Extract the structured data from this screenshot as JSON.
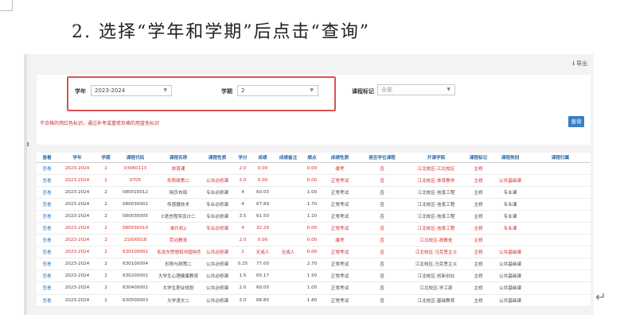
{
  "heading": "2. 选择“学年和学期”后点击“查询”",
  "toolbar": {
    "export_label": "导出",
    "export_icon": "download-icon"
  },
  "filters": {
    "year_label": "学年",
    "year_value": "2023-2024",
    "term_label": "学期",
    "term_value": "2",
    "course_flag_label": "课程标记",
    "course_flag_value": "全部"
  },
  "notice": "不合格的用红色标识，通过补考或重修及格的用蓝色标识",
  "query_label": "查询",
  "table": {
    "columns": [
      "查看",
      "学年",
      "学期",
      "课程代码",
      "课程名称",
      "课程性质",
      "学分",
      "成绩",
      "成绩备注",
      "绩点",
      "成绩性质",
      "是否学位课程",
      "开课学院",
      "课程标记",
      "课程类别",
      "课程归属"
    ],
    "rows": [
      {
        "red": true,
        "cells": [
          "查看",
          "2023-2024",
          "2",
          "03060113",
          "体育课",
          "",
          "2.0",
          "0.00",
          "",
          "0.00",
          "缓考",
          "否",
          "江北校区-江北校区",
          "主修",
          "",
          ""
        ]
      },
      {
        "red": true,
        "cells": [
          "查看",
          "2023-2024",
          "2",
          "0705",
          "形势政策二",
          "公共必修课",
          "2.0",
          "0.00",
          "",
          "0.00",
          "正常考试",
          "否",
          "江北校区-体育教学",
          "主修",
          "公共基础课",
          ""
        ]
      },
      {
        "red": false,
        "cells": [
          "查看",
          "2023-2024",
          "2",
          "080010012",
          "网页布局",
          "专业必修课",
          "4",
          "60.03",
          "",
          "1.00",
          "正常考试",
          "否",
          "江北校区-信息工程",
          "主修",
          "专业课",
          ""
        ]
      },
      {
        "red": false,
        "cells": [
          "查看",
          "2023-2024",
          "2",
          "080030002",
          "传感器技术",
          "专业必修课",
          "4",
          "67.89",
          "",
          "1.70",
          "正常考试",
          "否",
          "江北校区-信息工程",
          "主修",
          "专业课",
          ""
        ]
      },
      {
        "red": false,
        "cells": [
          "查看",
          "2023-2024",
          "2",
          "080030005",
          "C语言程序设计二",
          "专业必修课",
          "3.5",
          "61.50",
          "",
          "1.10",
          "正常考试",
          "否",
          "江北校区-信息工程",
          "主修",
          "专业课",
          ""
        ]
      },
      {
        "red": true,
        "cells": [
          "查看",
          "2023-2024",
          "2",
          "080030010",
          "单片机2",
          "专业必修课",
          "4",
          "32.29",
          "",
          "0.00",
          "正常考试",
          "否",
          "江北校区-信息工程",
          "主修",
          "专业课",
          ""
        ]
      },
      {
        "red": true,
        "cells": [
          "查看",
          "2023-2024",
          "2",
          "21000018",
          "劳动教育",
          "",
          "2.0",
          "0.00",
          "",
          "0.00",
          "缓考",
          "否",
          "江北校区-政教处",
          "主修",
          "",
          ""
        ]
      },
      {
        "red": true,
        "cells": [
          "查看",
          "2023-2024",
          "2",
          "630100002",
          "毛泽东思想和中国特色",
          "公共必修课",
          "2",
          "无成人",
          "无成人",
          "0.00",
          "正常考试",
          "否",
          "江北校区-马克思主义",
          "主修",
          "公共基础课",
          ""
        ]
      },
      {
        "red": false,
        "cells": [
          "查看",
          "2023-2024",
          "2",
          "630100004",
          "形势与政策二",
          "公共必修课",
          "0.25",
          "77.00",
          "",
          "2.70",
          "正常考试",
          "否",
          "江北校区-马克思主义",
          "主修",
          "公共基础课",
          ""
        ]
      },
      {
        "red": false,
        "cells": [
          "查看",
          "2023-2024",
          "2",
          "630200002",
          "大学生心理健康教育",
          "公共必修课",
          "1.5",
          "65.17",
          "",
          "1.50",
          "正常考试",
          "否",
          "江北校区-创新创业",
          "主修",
          "公共基础课",
          ""
        ]
      },
      {
        "red": false,
        "cells": [
          "查看",
          "2023-2024",
          "2",
          "630400001",
          "大学生职业规划",
          "公共必修课",
          "2.0",
          "60.00",
          "",
          "1.00",
          "正常考试",
          "否",
          "江北校区-学工部",
          "主修",
          "公共基础课",
          ""
        ]
      },
      {
        "red": false,
        "cells": [
          "查看",
          "2023-2024",
          "2",
          "630500003",
          "大学语文二",
          "公共必修课",
          "2.0",
          "68.80",
          "",
          "1.80",
          "正常考试",
          "否",
          "江北校区-基础教育",
          "主修",
          "公共基础课",
          ""
        ]
      }
    ]
  }
}
